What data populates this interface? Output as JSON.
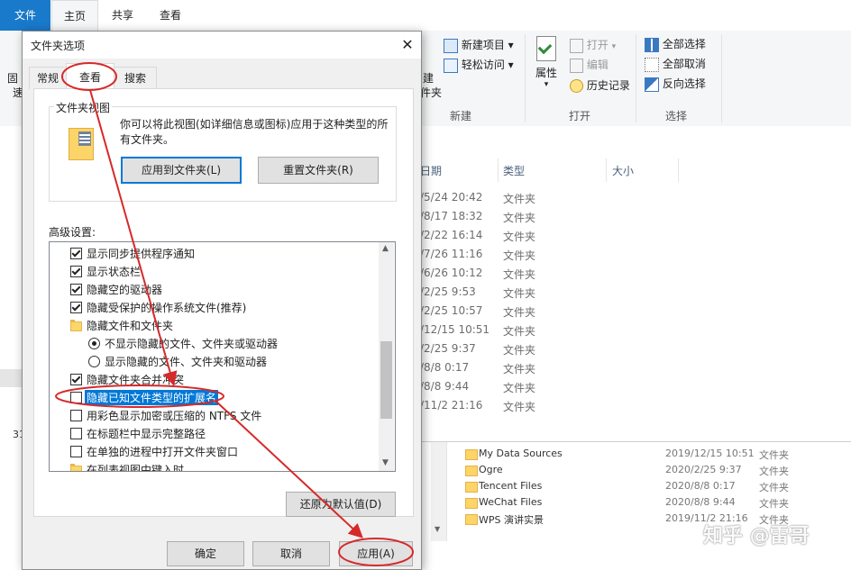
{
  "ribbon": {
    "tabs": [
      "文件",
      "主页",
      "共享",
      "查看"
    ],
    "new_group": {
      "new_item": "新建项目",
      "easy_access": "轻松访问",
      "new_folder_partial": "建",
      "new_folder_partial2": "件夹",
      "label": "新建"
    },
    "open_group": {
      "properties": "属性",
      "open": "打开",
      "edit": "编辑",
      "history": "历史记录",
      "label": "打开"
    },
    "select_group": {
      "select_all": "全部选择",
      "select_none": "全部取消",
      "invert": "反向选择",
      "label": "选择"
    },
    "left_partial": {
      "a": "固",
      "b": "速"
    }
  },
  "file_list": {
    "headers": {
      "date": "日期",
      "type": "类型",
      "size": "大小"
    },
    "rows": [
      {
        "date": "/5/24 20:42",
        "type": "文件夹"
      },
      {
        "date": "/8/17 18:32",
        "type": "文件夹"
      },
      {
        "date": "/2/22 16:14",
        "type": "文件夹"
      },
      {
        "date": "/7/26 11:16",
        "type": "文件夹"
      },
      {
        "date": "/6/26 10:12",
        "type": "文件夹"
      },
      {
        "date": "/2/25 9:53",
        "type": "文件夹"
      },
      {
        "date": "/2/25 10:57",
        "type": "文件夹"
      },
      {
        "date": "/12/15 10:51",
        "type": "文件夹"
      },
      {
        "date": "/2/25 9:37",
        "type": "文件夹"
      },
      {
        "date": "/8/8 0:17",
        "type": "文件夹"
      },
      {
        "date": "/8/8 9:44",
        "type": "文件夹"
      },
      {
        "date": "/11/2 21:16",
        "type": "文件夹"
      }
    ],
    "left_status_partial": "31"
  },
  "bottom_list": {
    "rows": [
      {
        "name": "My Data Sources",
        "date": "2019/12/15 10:51",
        "type": "文件夹"
      },
      {
        "name": "Ogre",
        "date": "2020/2/25 9:37",
        "type": "文件夹"
      },
      {
        "name": "Tencent Files",
        "date": "2020/8/8 0:17",
        "type": "文件夹"
      },
      {
        "name": "WeChat Files",
        "date": "2020/8/8 9:44",
        "type": "文件夹"
      },
      {
        "name": "WPS 演讲实景",
        "date": "2019/11/2 21:16",
        "type": "文件夹"
      }
    ]
  },
  "watermark": "知乎 @雷哥",
  "dialog": {
    "title": "文件夹选项",
    "tabs": [
      "常规",
      "查看",
      "搜索"
    ],
    "folder_views": {
      "legend": "文件夹视图",
      "description": "你可以将此视图(如详细信息或图标)应用于这种类型的所有文件夹。",
      "apply_button": "应用到文件夹(L)",
      "reset_button": "重置文件夹(R)"
    },
    "advanced_label": "高级设置:",
    "options": [
      {
        "kind": "check",
        "checked": true,
        "label": "显示同步提供程序通知"
      },
      {
        "kind": "check",
        "checked": true,
        "label": "显示状态栏"
      },
      {
        "kind": "check",
        "checked": true,
        "label": "隐藏空的驱动器"
      },
      {
        "kind": "check",
        "checked": true,
        "label": "隐藏受保护的操作系统文件(推荐)"
      },
      {
        "kind": "folder",
        "checked": false,
        "label": "隐藏文件和文件夹"
      },
      {
        "kind": "radio",
        "checked": true,
        "label": "不显示隐藏的文件、文件夹或驱动器"
      },
      {
        "kind": "radio",
        "checked": false,
        "label": "显示隐藏的文件、文件夹和驱动器"
      },
      {
        "kind": "check",
        "checked": true,
        "label": "隐藏文件夹合并冲突"
      },
      {
        "kind": "check",
        "checked": false,
        "label": "隐藏已知文件类型的扩展名",
        "selected": true
      },
      {
        "kind": "check",
        "checked": false,
        "label": "用彩色显示加密或压缩的 NTFS 文件"
      },
      {
        "kind": "check",
        "checked": false,
        "label": "在标题栏中显示完整路径"
      },
      {
        "kind": "check",
        "checked": false,
        "label": "在单独的进程中打开文件夹窗口"
      },
      {
        "kind": "folder",
        "checked": false,
        "label": "在列表视图中键入时"
      }
    ],
    "restore_defaults": "还原为默认值(D)",
    "ok": "确定",
    "cancel": "取消",
    "apply": "应用(A)"
  },
  "colors": {
    "accent": "#0078d7",
    "annotation": "#d62929",
    "selection": "#0078d7"
  }
}
